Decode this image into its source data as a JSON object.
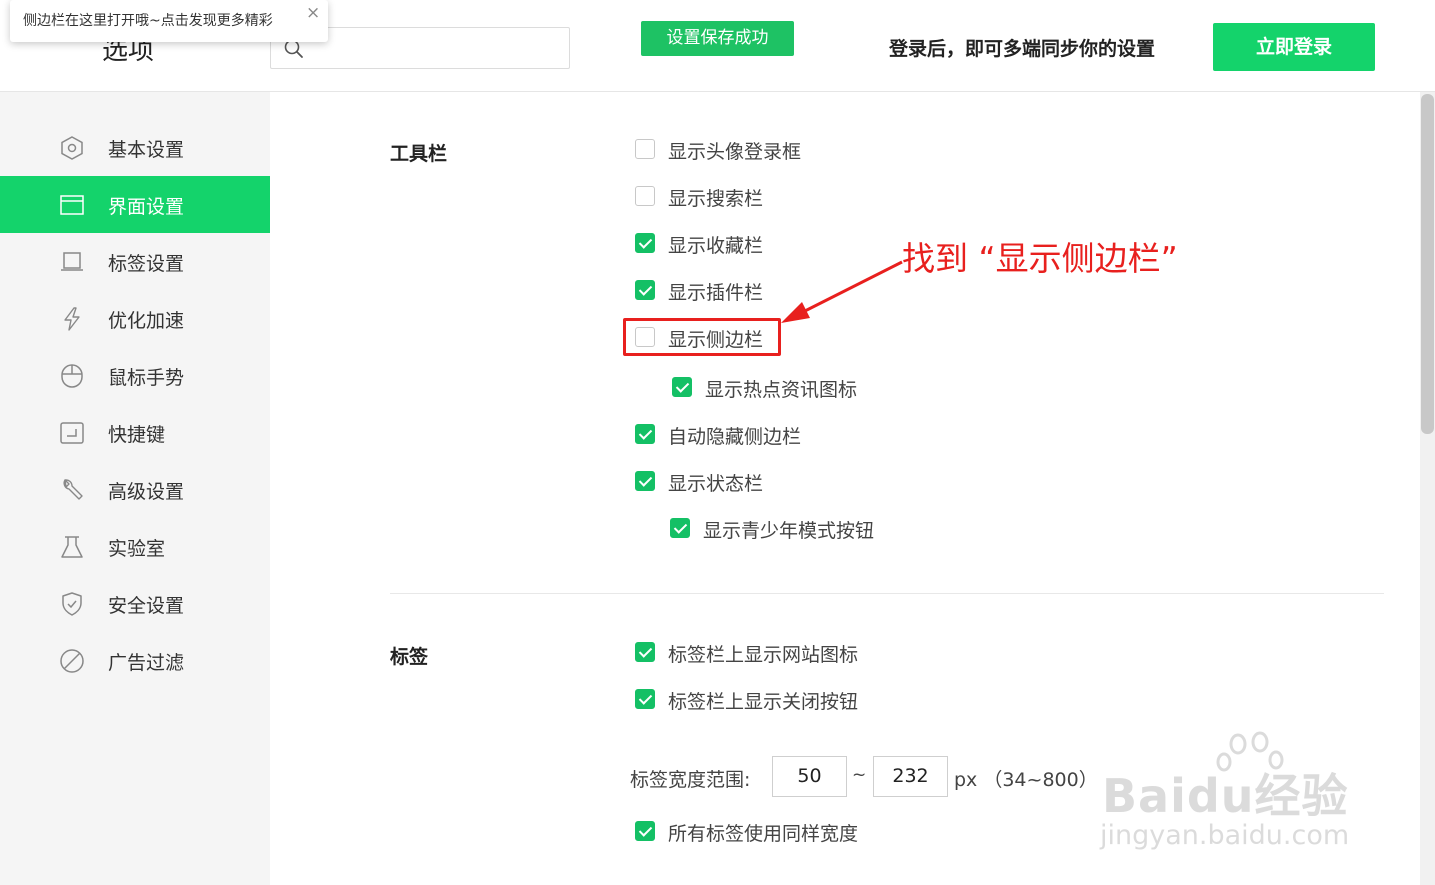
{
  "header": {
    "title": "选项",
    "search": {
      "value": "",
      "placeholder": ""
    },
    "toast": "设置保存成功",
    "login_hint": "登录后，即可多端同步你的设置",
    "login_button": "立即登录"
  },
  "tip": {
    "text": "侧边栏在这里打开哦~点击发现更多精彩",
    "close": "×"
  },
  "sidebar": {
    "items": [
      {
        "label": "基本设置",
        "icon": "hexagon-settings-icon",
        "active": false
      },
      {
        "label": "界面设置",
        "icon": "window-icon",
        "active": true
      },
      {
        "label": "标签设置",
        "icon": "tab-icon",
        "active": false
      },
      {
        "label": "优化加速",
        "icon": "lightning-icon",
        "active": false
      },
      {
        "label": "鼠标手势",
        "icon": "mouse-icon",
        "active": false
      },
      {
        "label": "快捷键",
        "icon": "shortcut-icon",
        "active": false
      },
      {
        "label": "高级设置",
        "icon": "wrench-icon",
        "active": false
      },
      {
        "label": "实验室",
        "icon": "flask-icon",
        "active": false
      },
      {
        "label": "安全设置",
        "icon": "shield-icon",
        "active": false
      },
      {
        "label": "广告过滤",
        "icon": "block-icon",
        "active": false
      }
    ]
  },
  "toolbar_section": {
    "title": "工具栏",
    "options": [
      {
        "label": "显示头像登录框",
        "checked": false
      },
      {
        "label": "显示搜索栏",
        "checked": false
      },
      {
        "label": "显示收藏栏",
        "checked": true
      },
      {
        "label": "显示插件栏",
        "checked": true
      },
      {
        "label": "显示侧边栏",
        "checked": false
      },
      {
        "label": "显示热点资讯图标",
        "checked": true
      },
      {
        "label": "自动隐藏侧边栏",
        "checked": true
      },
      {
        "label": "显示状态栏",
        "checked": true
      },
      {
        "label": "显示青少年模式按钮",
        "checked": true
      }
    ]
  },
  "tabs_section": {
    "title": "标签",
    "options": [
      {
        "label": "标签栏上显示网站图标",
        "checked": true
      },
      {
        "label": "标签栏上显示关闭按钮",
        "checked": true
      },
      {
        "label": "所有标签使用同样宽度",
        "checked": true
      }
    ],
    "width_range": {
      "label": "标签宽度范围:",
      "min": "50",
      "separator": "~",
      "max": "232",
      "unit": "px （34~800）"
    }
  },
  "annotation": {
    "text": "找到 “显示侧边栏”",
    "color": "#e8201e"
  },
  "watermark": {
    "logo": "Baidu经验",
    "url": "jingyan.baidu.com"
  },
  "colors": {
    "accent": "#14d36b",
    "checkbox_on": "#14c065",
    "toast": "#1ec264"
  }
}
